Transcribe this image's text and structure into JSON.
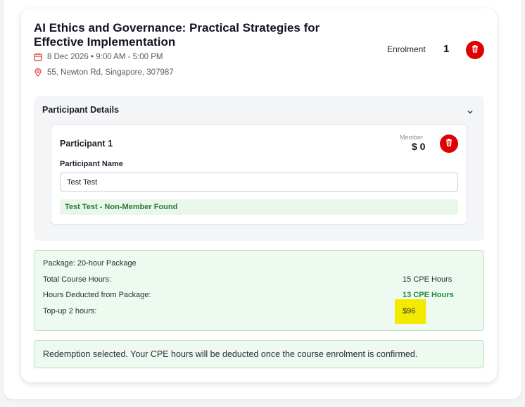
{
  "course": {
    "title": "AI Ethics and Governance: Practical Strategies for Effective Implementation",
    "date_time": "8 Dec 2026 • 9:00 AM - 5:00 PM",
    "address": "55, Newton Rd, Singapore, 307987",
    "enrolment_label": "Enrolment",
    "enrolment_count": "1"
  },
  "participant_section": {
    "title": "Participant Details",
    "participant": {
      "heading": "Participant 1",
      "member_label": "Member",
      "member_price": "$ 0",
      "name_label": "Participant Name",
      "name_value": "Test Test",
      "status_message": "Test Test - Non-Member Found"
    }
  },
  "package": {
    "package_line": "Package: 20-hour Package",
    "rows": [
      {
        "label": "Total Course Hours:",
        "value": "15 CPE Hours"
      },
      {
        "label": "Hours Deducted from Package:",
        "value": "13 CPE Hours"
      },
      {
        "label": "Top-up 2 hours:",
        "value": "$96"
      }
    ]
  },
  "redemption_message": "Redemption selected. Your CPE hours will be deducted once the course enrolment is confirmed.",
  "colors": {
    "delete_red": "#e00000",
    "success_green": "#1f8a3b",
    "highlight_yellow": "#f4ea00"
  }
}
